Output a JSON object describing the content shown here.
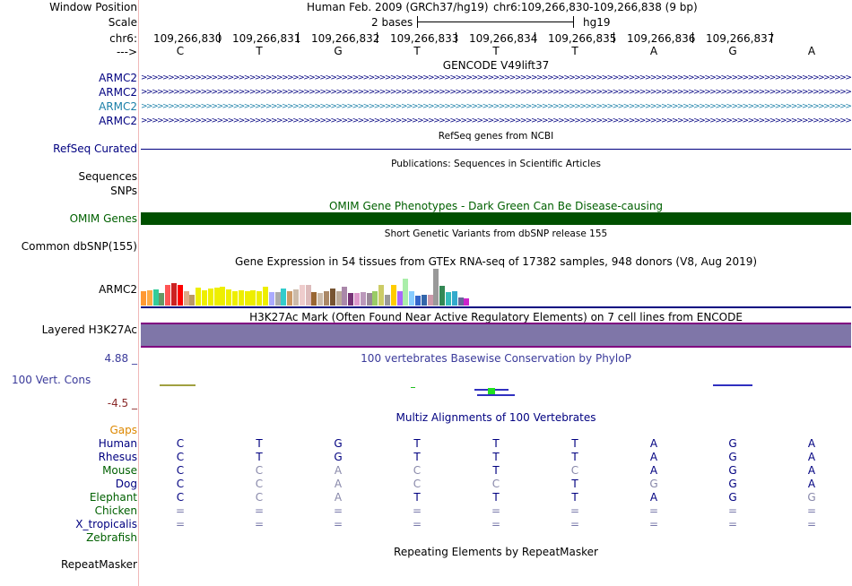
{
  "window_position": {
    "label": "Window Position",
    "assembly": "Human Feb. 2009 (GRCh37/hg19)",
    "range": "chr6:109,266,830-109,266,838 (9 bp)"
  },
  "scale": {
    "label": "Scale",
    "bases": "2 bases",
    "assembly": "hg19"
  },
  "chrom": {
    "label": "chr6:",
    "positions": [
      "109,266,830",
      "109,266,831",
      "109,266,832",
      "109,266,833",
      "109,266,834",
      "109,266,835",
      "109,266,836",
      "109,266,837"
    ]
  },
  "strand": {
    "label": "--->",
    "bases": [
      "C",
      "T",
      "G",
      "T",
      "T",
      "T",
      "A",
      "G",
      "A"
    ]
  },
  "gencode": {
    "title": "GENCODE V49lift37",
    "genes": [
      "ARMC2",
      "ARMC2",
      "ARMC2",
      "ARMC2"
    ],
    "colors": [
      "#000080",
      "#000080",
      "#1a7fa8",
      "#000080"
    ]
  },
  "refseq": {
    "label": "RefSeq Curated",
    "title": "RefSeq genes from NCBI"
  },
  "publications": {
    "title": "Publications: Sequences in Scientific Articles",
    "labels": [
      "Sequences",
      "SNPs"
    ]
  },
  "omim": {
    "label": "OMIM Genes",
    "title": "OMIM Gene Phenotypes - Dark Green Can Be Disease-causing",
    "color": "#006000"
  },
  "dbsnp": {
    "label": "Common dbSNP(155)",
    "title": "Short Genetic Variants from dbSNP release 155"
  },
  "gtex": {
    "title": "Gene Expression in 54 tissues from GTEx RNA-seq of 17382 samples, 948 donors (V8, Aug 2019)",
    "label": "ARMC2",
    "tissues": [
      {
        "v": 0.38,
        "c": "#ff9933"
      },
      {
        "v": 0.42,
        "c": "#ffaa44"
      },
      {
        "v": 0.45,
        "c": "#33cc99"
      },
      {
        "v": 0.35,
        "c": "#669966"
      },
      {
        "v": 0.55,
        "c": "#ff5555"
      },
      {
        "v": 0.62,
        "c": "#cc2222"
      },
      {
        "v": 0.55,
        "c": "#ff0000"
      },
      {
        "v": 0.4,
        "c": "#ddaa88"
      },
      {
        "v": 0.3,
        "c": "#bb9966"
      },
      {
        "v": 0.48,
        "c": "#eeee00"
      },
      {
        "v": 0.42,
        "c": "#eeee00"
      },
      {
        "v": 0.46,
        "c": "#eeee00"
      },
      {
        "v": 0.48,
        "c": "#eeee00"
      },
      {
        "v": 0.5,
        "c": "#eeee00"
      },
      {
        "v": 0.44,
        "c": "#eeee00"
      },
      {
        "v": 0.4,
        "c": "#eeee00"
      },
      {
        "v": 0.42,
        "c": "#eeee00"
      },
      {
        "v": 0.4,
        "c": "#eeee00"
      },
      {
        "v": 0.42,
        "c": "#eeee00"
      },
      {
        "v": 0.4,
        "c": "#eeee00"
      },
      {
        "v": 0.52,
        "c": "#eeee00"
      },
      {
        "v": 0.36,
        "c": "#aaaaff"
      },
      {
        "v": 0.36,
        "c": "#aaaaaa"
      },
      {
        "v": 0.46,
        "c": "#33cccc"
      },
      {
        "v": 0.4,
        "c": "#cc9966"
      },
      {
        "v": 0.44,
        "c": "#ccbbaa"
      },
      {
        "v": 0.56,
        "c": "#eecccc"
      },
      {
        "v": 0.56,
        "c": "#ddbbbb"
      },
      {
        "v": 0.36,
        "c": "#996633"
      },
      {
        "v": 0.34,
        "c": "#ccbbaa"
      },
      {
        "v": 0.38,
        "c": "#aa8866"
      },
      {
        "v": 0.46,
        "c": "#775533"
      },
      {
        "v": 0.4,
        "c": "#bbaa99"
      },
      {
        "v": 0.52,
        "c": "#aa88aa"
      },
      {
        "v": 0.34,
        "c": "#773377"
      },
      {
        "v": 0.34,
        "c": "#dd99cc"
      },
      {
        "v": 0.36,
        "c": "#bb99bb"
      },
      {
        "v": 0.34,
        "c": "#998899"
      },
      {
        "v": 0.4,
        "c": "#99cc66"
      },
      {
        "v": 0.56,
        "c": "#cccc66"
      },
      {
        "v": 0.3,
        "c": "#999999"
      },
      {
        "v": 0.56,
        "c": "#ffcc00"
      },
      {
        "v": 0.4,
        "c": "#aa66ff"
      },
      {
        "v": 0.72,
        "c": "#aaeeaa"
      },
      {
        "v": 0.4,
        "c": "#88ccff"
      },
      {
        "v": 0.26,
        "c": "#3366cc"
      },
      {
        "v": 0.3,
        "c": "#3366aa"
      },
      {
        "v": 0.3,
        "c": "#cc99aa"
      },
      {
        "v": 1.0,
        "c": "#999999"
      },
      {
        "v": 0.54,
        "c": "#338855"
      },
      {
        "v": 0.36,
        "c": "#33bbbb"
      },
      {
        "v": 0.4,
        "c": "#33aacc"
      },
      {
        "v": 0.22,
        "c": "#666699"
      },
      {
        "v": 0.2,
        "c": "#cc22cc"
      }
    ]
  },
  "h3k27ac": {
    "label": "Layered H3K27Ac",
    "title": "H3K27Ac Mark (Often Found Near Active Regulatory Elements) on 7 cell lines from ENCODE",
    "color": "#7f76a8"
  },
  "phylop": {
    "title": "100 vertebrates Basewise Conservation by PhyloP",
    "label": "100 Vert. Cons",
    "max": "4.88 _",
    "min": "-4.5 _"
  },
  "multiz": {
    "title": "Multiz Alignments of 100 Vertebrates",
    "gaps_label": "Gaps",
    "species": [
      {
        "name": "Human",
        "color": "#000080",
        "bases": [
          "C",
          "T",
          "G",
          "T",
          "T",
          "T",
          "A",
          "G",
          "A"
        ]
      },
      {
        "name": "Rhesus",
        "color": "#000080",
        "bases": [
          "C",
          "T",
          "G",
          "T",
          "T",
          "T",
          "A",
          "G",
          "A"
        ]
      },
      {
        "name": "Mouse",
        "color": "#006000",
        "bases": [
          "C",
          "C",
          "A",
          "C",
          "T",
          "C",
          "A",
          "G",
          "A"
        ]
      },
      {
        "name": "Dog",
        "color": "#000080",
        "bases": [
          "C",
          "C",
          "A",
          "C",
          "C",
          "T",
          "G",
          "G",
          "A"
        ]
      },
      {
        "name": "Elephant",
        "color": "#006000",
        "bases": [
          "C",
          "C",
          "A",
          "T",
          "T",
          "T",
          "A",
          "G",
          "G"
        ]
      },
      {
        "name": "Chicken",
        "color": "#006000",
        "bases": [
          "=",
          "=",
          "=",
          "=",
          "=",
          "=",
          "=",
          "=",
          "="
        ]
      },
      {
        "name": "X_tropicalis",
        "color": "#000080",
        "bases": [
          "=",
          "=",
          "=",
          "=",
          "=",
          "=",
          "=",
          "=",
          "="
        ]
      },
      {
        "name": "Zebrafish",
        "color": "#006000",
        "bases": []
      }
    ]
  },
  "repeatmasker": {
    "label": "RepeatMasker",
    "title": "Repeating Elements by RepeatMasker"
  }
}
